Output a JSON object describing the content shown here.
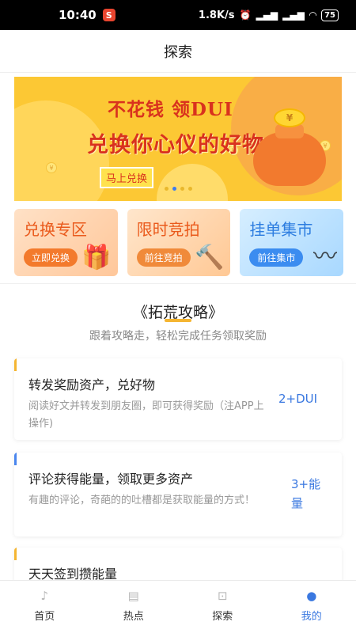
{
  "status_bar": {
    "time": "10:40",
    "app_badge": "S",
    "net_speed": "1.8K/s",
    "battery": "75"
  },
  "nav": {
    "title": "探索"
  },
  "banner": {
    "line1": "不花钱 领DUI",
    "line2": "兑换你心仪的好物",
    "button": "马上兑换",
    "coin_symbol": "¥",
    "dots_count": 4,
    "active_dot": 1
  },
  "cards": [
    {
      "title": "兑换专区",
      "button": "立即兑换",
      "icon": "gift-icon"
    },
    {
      "title": "限时竞拍",
      "button": "前往竞拍",
      "icon": "gavel-icon"
    },
    {
      "title": "挂单集市",
      "button": "前往集市",
      "icon": "wave-icon"
    }
  ],
  "section": {
    "title": "《拓荒攻略》",
    "subtitle": "跟着攻略走，轻松完成任务领取奖励"
  },
  "tasks": [
    {
      "title": "转发奖励资产，兑好物",
      "desc": "阅读好文并转发到朋友圈，即可获得奖励（注APP上操作)",
      "reward": "2+DUI",
      "accent": "#f5b531"
    },
    {
      "title": "评论获得能量，领取更多资产",
      "desc": "有趣的评论，奇葩的的吐槽都是获取能量的方式！",
      "reward": "3+能量",
      "accent": "#4a86ee"
    },
    {
      "title": "天天签到攒能量",
      "desc": "",
      "reward": "",
      "accent": "#f5b531"
    }
  ],
  "tabbar": [
    {
      "label": "首页",
      "icon": "music-note-icon",
      "active": false
    },
    {
      "label": "热点",
      "icon": "news-icon",
      "active": false
    },
    {
      "label": "探索",
      "icon": "basket-icon",
      "active": false
    },
    {
      "label": "我的",
      "icon": "user-icon",
      "active": true
    }
  ]
}
